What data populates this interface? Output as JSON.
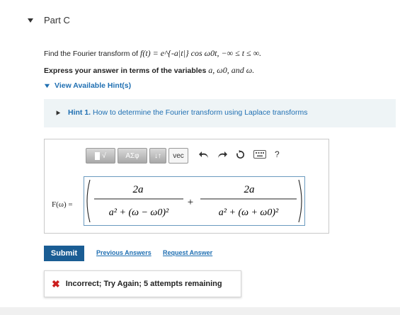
{
  "part": {
    "title": "Part C"
  },
  "question": {
    "prefix": "Find the Fourier transform of",
    "function": "f(t) = e^{-a|t|} cos ω0t, −∞ ≤ t ≤ ∞."
  },
  "instruction": {
    "prefix": "Express your answer in terms of the variables",
    "vars": "a, ω0, and ω."
  },
  "hints": {
    "toggle_label": "View Available Hint(s)",
    "items": [
      {
        "number": "Hint 1.",
        "text": "How to determine the Fourier transform using Laplace transforms"
      }
    ]
  },
  "answer": {
    "label": "F(ω) =",
    "toolbar": {
      "sqrt": "√",
      "greek": "ΑΣφ",
      "sort": "↓↑",
      "vec": "vec",
      "help": "?"
    },
    "expression": {
      "term1_numerator": "2a",
      "term1_denominator": "a² + (ω − ω0)²",
      "operator": "+",
      "term2_numerator": "2a",
      "term2_denominator": "a² + (ω + ω0)²"
    }
  },
  "actions": {
    "submit": "Submit",
    "previous_answers": "Previous Answers",
    "request_answer": "Request Answer"
  },
  "feedback": {
    "icon": "✖",
    "message": "Incorrect; Try Again; 5 attempts remaining"
  },
  "colors": {
    "link": "#1f6fb2",
    "submit_bg": "#1a5d94",
    "error": "#cc1f1f",
    "hint_bg": "#eef4f6"
  }
}
